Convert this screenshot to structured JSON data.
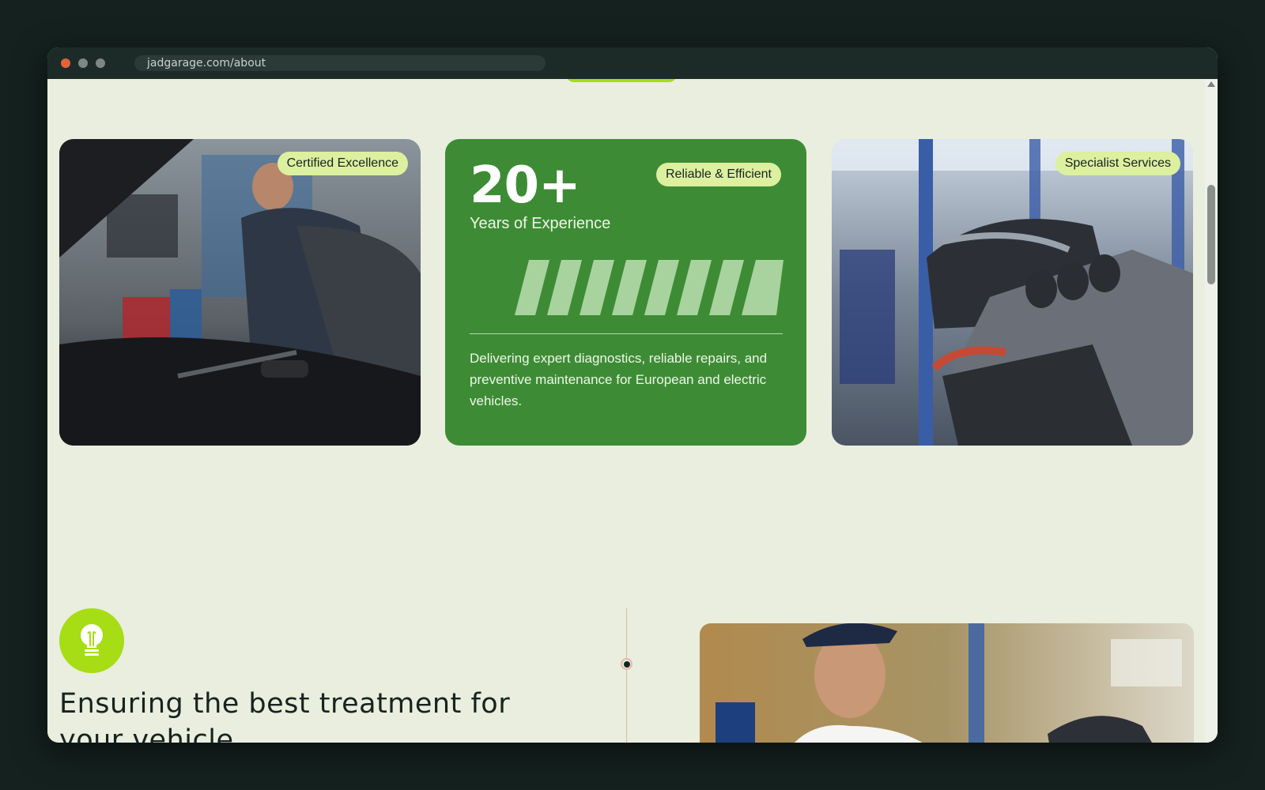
{
  "browser": {
    "url": "jadgarage.com/about"
  },
  "cards": {
    "certified": {
      "badge": "Certified Excellence",
      "image": "mechanic inspecting car engine with diagnostic tool"
    },
    "experience": {
      "badge": "Reliable & Efficient",
      "stat_value": "20+",
      "stat_label": "Years of Experience",
      "description": "Delivering expert diagnostics, reliable repairs, and preventive maintenance for European and electric vehicles."
    },
    "specialist": {
      "badge": "Specialist Services",
      "image": "engine block on workshop stand"
    }
  },
  "section": {
    "icon": "lightbulb-icon",
    "heading": "Ensuring the best treatment for your vehicle"
  },
  "colors": {
    "accent_green": "#3d8c35",
    "lime": "#a6dd14",
    "badge_bg": "#dcf0a0",
    "page_bg": "#e9eedf"
  }
}
